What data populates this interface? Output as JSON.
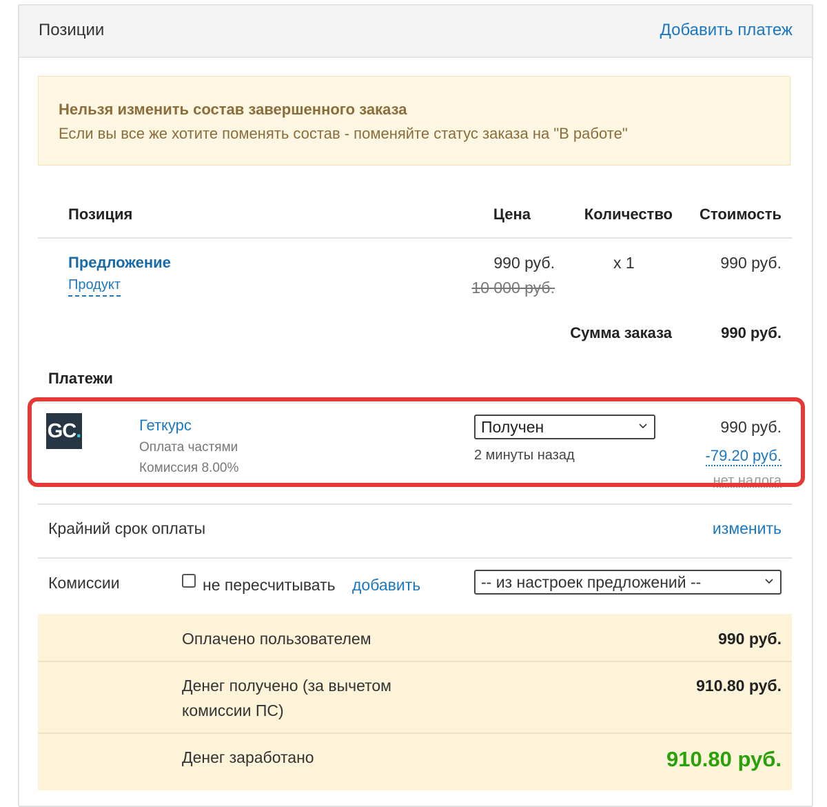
{
  "header": {
    "title": "Позиции",
    "add_payment": "Добавить платеж"
  },
  "alert": {
    "title": "Нельзя изменить состав завершенного заказа",
    "text": "Если вы все же хотите поменять состав - поменяйте статус заказа на \"В работе\""
  },
  "table": {
    "headers": {
      "position": "Позиция",
      "price": "Цена",
      "quantity": "Количество",
      "cost": "Стоимость"
    },
    "rows": [
      {
        "title": "Предложение",
        "subtitle": "Продукт",
        "price": "990 руб.",
        "old_price": "10 000 руб.",
        "quantity": "x 1",
        "cost": "990 руб."
      }
    ],
    "total_label": "Сумма заказа",
    "total_value": "990 руб."
  },
  "payments": {
    "title": "Платежи",
    "items": [
      {
        "logo_text": "GC",
        "logo_dot": ".",
        "name": "Геткурс",
        "method": "Оплата частями",
        "commission": "Комиссия 8.00%",
        "status": "Получен",
        "time_ago": "2 минуты назад",
        "amount": "990 руб.",
        "fee": "-79.20 руб.",
        "tax": "нет налога"
      }
    ]
  },
  "deadline": {
    "label": "Крайний срок оплаты",
    "change": "изменить"
  },
  "commissions": {
    "label": "Комиссии",
    "checkbox_label": "не пересчитывать",
    "add_link": "добавить",
    "select_value": "-- из настроек предложений --"
  },
  "summary": {
    "paid_label": "Оплачено пользователем",
    "paid_value": "990 руб.",
    "received_label_1": "Денег получено (за вычетом",
    "received_label_2": "комиссии ПС)",
    "received_value": "910.80 руб.",
    "earned_label": "Денег заработано",
    "earned_value": "910.80 руб."
  },
  "colors": {
    "link": "#1a78c2",
    "alert_bg": "#fcf6e3",
    "alert_text": "#8a6d3b",
    "summary_bg": "#fcf3d8",
    "highlight_border": "#e53935",
    "earned_green": "#28a10a"
  }
}
